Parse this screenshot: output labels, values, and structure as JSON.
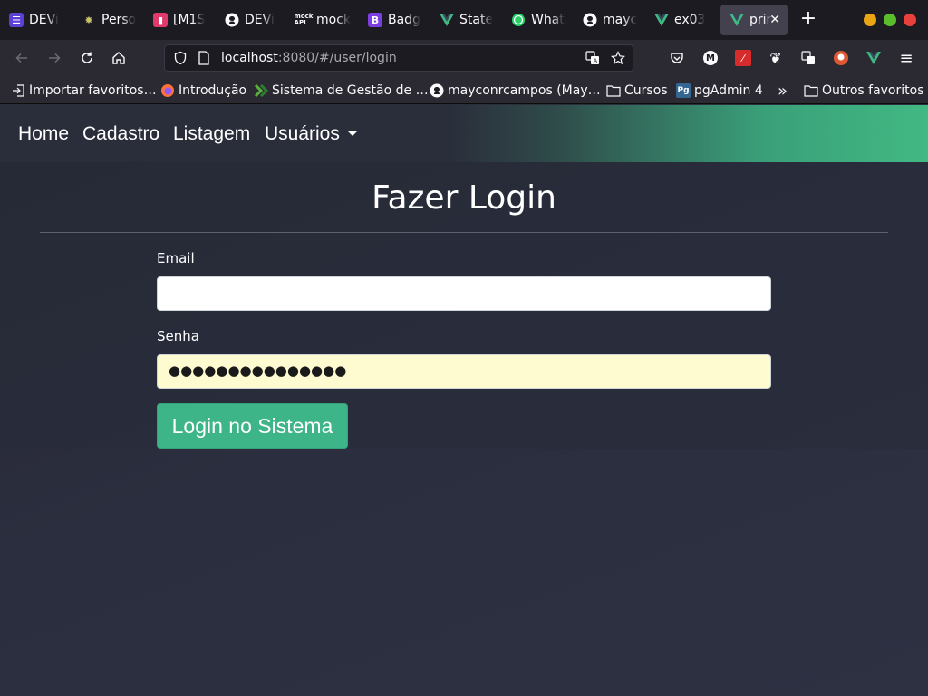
{
  "browser": {
    "tabs": [
      {
        "label": "DEVi",
        "icon": "list-icon",
        "color": "#5b3fd6"
      },
      {
        "label": "Perso",
        "icon": "palette-icon",
        "color": "#8a8a5a"
      },
      {
        "label": "[M1S",
        "icon": "trello-icon",
        "color": "#e03a6a"
      },
      {
        "label": "DEVi",
        "icon": "github-icon",
        "color": "#fbfbfe"
      },
      {
        "label": "mock",
        "icon": "mockapi-icon",
        "color": "#fbfbfe"
      },
      {
        "label": "Badg",
        "icon": "bootstrap-icon",
        "color": "#7a3fe0"
      },
      {
        "label": "State",
        "icon": "vue-icon",
        "color": "#42b883"
      },
      {
        "label": "What",
        "icon": "whatsapp-icon",
        "color": "#25d366"
      },
      {
        "label": "mayc",
        "icon": "github-icon",
        "color": "#fbfbfe"
      },
      {
        "label": "ex03",
        "icon": "vue-icon",
        "color": "#42b883"
      },
      {
        "label": "prin",
        "icon": "vue-icon",
        "color": "#42b883"
      }
    ],
    "new_tab_label": "+",
    "close_glyph": "✕",
    "window_colors": {
      "minimize": "#e9a514",
      "maximize": "#5bbd2b",
      "close": "#e8403a"
    },
    "url": {
      "host": "localhost",
      "rest": ":8080/#/user/login"
    },
    "bookmarks": [
      {
        "label": "Importar favoritos…",
        "icon": "import-icon"
      },
      {
        "label": "Introdução",
        "icon": "firefox-icon"
      },
      {
        "label": "Sistema de Gestão de …",
        "icon": "chevron-logo-icon"
      },
      {
        "label": "mayconrcampos (May…",
        "icon": "github-icon"
      },
      {
        "label": "Cursos",
        "icon": "folder-icon"
      },
      {
        "label": "pgAdmin 4",
        "icon": "pgadmin-icon"
      },
      {
        "label": "Outros favoritos",
        "icon": "folder-icon"
      }
    ],
    "bookmarks_overflow": "»",
    "pg_icon_text": "Pg",
    "dots_menu": "≡"
  },
  "app": {
    "nav": {
      "home": "Home",
      "cadastro": "Cadastro",
      "listagem": "Listagem",
      "usuarios": "Usuários"
    },
    "title": "Fazer Login",
    "form": {
      "email_label": "Email",
      "email_value": "",
      "password_label": "Senha",
      "password_dots": "●●●●●●●●●●●●●●●",
      "submit_label": "Login no Sistema"
    },
    "accent_color": "#42b883"
  }
}
